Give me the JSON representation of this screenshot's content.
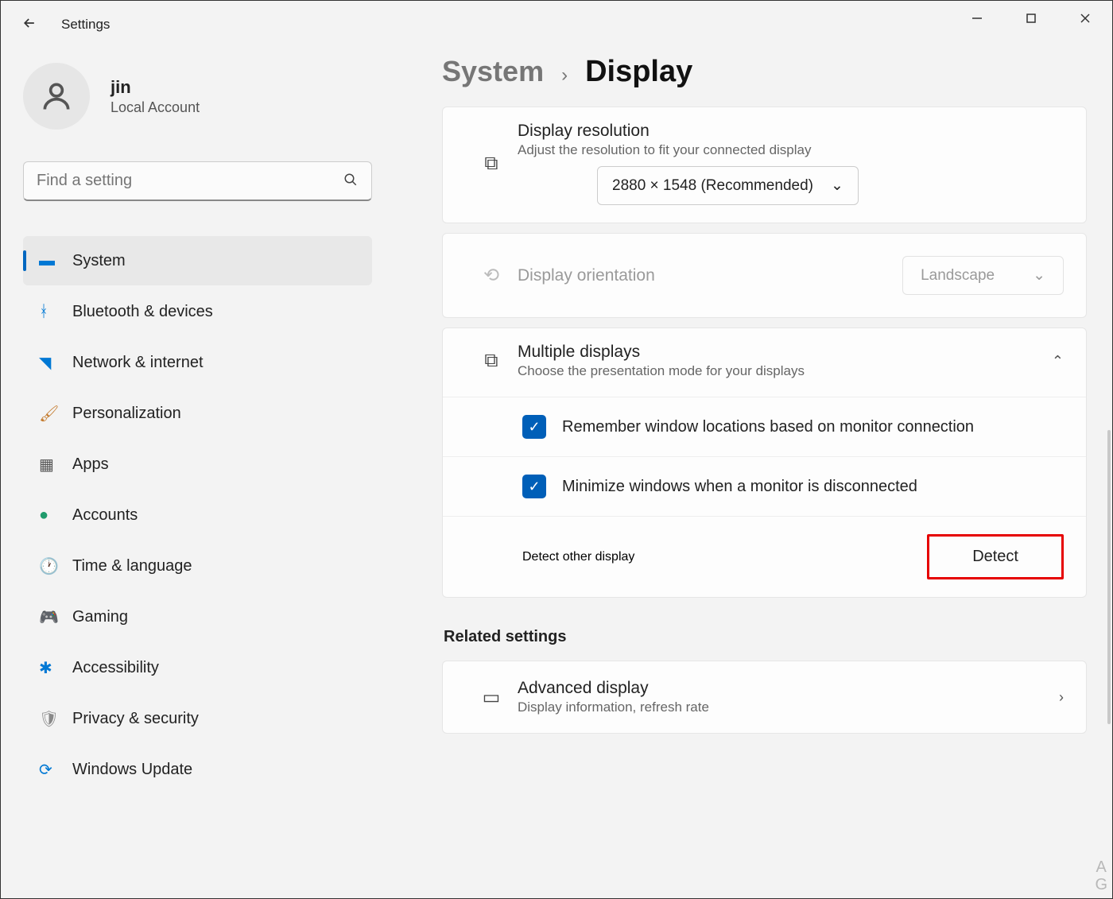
{
  "window": {
    "title": "Settings"
  },
  "profile": {
    "name": "jin",
    "subtitle": "Local Account"
  },
  "search": {
    "placeholder": "Find a setting"
  },
  "nav": {
    "items": [
      {
        "label": "System",
        "icon": "🖥️",
        "active": true
      },
      {
        "label": "Bluetooth & devices",
        "icon": "ᚼ"
      },
      {
        "label": "Network & internet",
        "icon": "📶"
      },
      {
        "label": "Personalization",
        "icon": "🖌️"
      },
      {
        "label": "Apps",
        "icon": "▦"
      },
      {
        "label": "Accounts",
        "icon": "👤"
      },
      {
        "label": "Time & language",
        "icon": "🕐"
      },
      {
        "label": "Gaming",
        "icon": "🎮"
      },
      {
        "label": "Accessibility",
        "icon": "✱"
      },
      {
        "label": "Privacy & security",
        "icon": "🛡️"
      },
      {
        "label": "Windows Update",
        "icon": "🔄"
      }
    ]
  },
  "breadcrumb": {
    "parent": "System",
    "current": "Display"
  },
  "resolution": {
    "title": "Display resolution",
    "subtitle": "Adjust the resolution to fit your connected display",
    "value": "2880 × 1548 (Recommended)"
  },
  "orientation": {
    "title": "Display orientation",
    "value": "Landscape"
  },
  "multi": {
    "title": "Multiple displays",
    "subtitle": "Choose the presentation mode for your displays",
    "opt1": "Remember window locations based on monitor connection",
    "opt2": "Minimize windows when a monitor is disconnected",
    "detect_label": "Detect other display",
    "detect_btn": "Detect"
  },
  "related": {
    "heading": "Related settings",
    "adv_title": "Advanced display",
    "adv_sub": "Display information, refresh rate"
  },
  "corner": {
    "a": "A",
    "g": "G"
  }
}
